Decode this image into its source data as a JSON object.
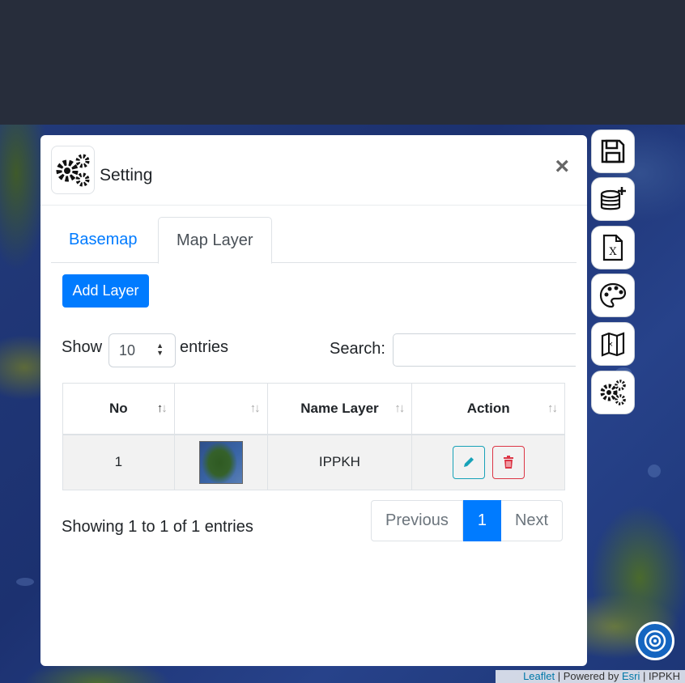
{
  "modal": {
    "title": "Setting",
    "close_glyph": "×",
    "header_icon": "gears-icon"
  },
  "tabs": [
    {
      "label": "Basemap",
      "active": false
    },
    {
      "label": "Map Layer",
      "active": true
    }
  ],
  "add_layer_label": "Add Layer",
  "table_controls": {
    "show_label": "Show",
    "length_value": "10",
    "entries_label": "entries",
    "search_label": "Search:",
    "search_value": ""
  },
  "table": {
    "columns": [
      "No",
      "",
      "Name Layer",
      "Action"
    ],
    "rows": [
      {
        "no": "1",
        "name": "IPPKH"
      }
    ]
  },
  "info_text": "Showing 1 to 1 of 1 entries",
  "pagination": {
    "previous": "Previous",
    "current": "1",
    "next": "Next"
  },
  "toolbar": [
    {
      "name": "save-icon"
    },
    {
      "name": "add-database-icon"
    },
    {
      "name": "excel-file-icon"
    },
    {
      "name": "palette-icon"
    },
    {
      "name": "map-icon"
    },
    {
      "name": "settings-icon"
    }
  ],
  "attribution": {
    "leaflet": "Leaflet",
    "powered_by": " | Powered by ",
    "esri": "Esri",
    "suffix": " | IPPKH"
  },
  "colors": {
    "primary": "#007bff",
    "topbar": "#272d3b",
    "edit": "#17a2b8",
    "delete": "#dc3545"
  }
}
